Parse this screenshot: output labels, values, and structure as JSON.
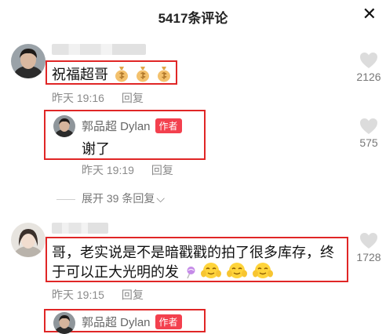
{
  "header": {
    "title": "5417条评论",
    "close_icon": "close-icon"
  },
  "comments": [
    {
      "text": "祝福超哥",
      "emoji": [
        "money-bag",
        "money-bag",
        "money-bag"
      ],
      "time": "昨天 19:16",
      "reply_label": "回复",
      "likes": "2126",
      "author_reply": {
        "name": "郭品超 Dylan",
        "badge": "作者",
        "text": "谢了",
        "time": "昨天 19:19",
        "reply_label": "回复",
        "likes": "575"
      },
      "expand_label": "展开 39 条回复"
    },
    {
      "text_line1": "哥，老实说是不是暗戳戳的拍了很多库存，终",
      "text_line2": "于可以正大光明的发",
      "emoji": [
        "lollipop",
        "clap-face",
        "clap-face",
        "clap-face"
      ],
      "time": "昨天 19:15",
      "reply_label": "回复",
      "likes": "1728",
      "author_reply": {
        "name": "郭品超 Dylan",
        "badge": "作者"
      }
    }
  ],
  "colors": {
    "highlight": "#e02626",
    "badge": "#f3404e",
    "meta": "#8a8a8a"
  }
}
